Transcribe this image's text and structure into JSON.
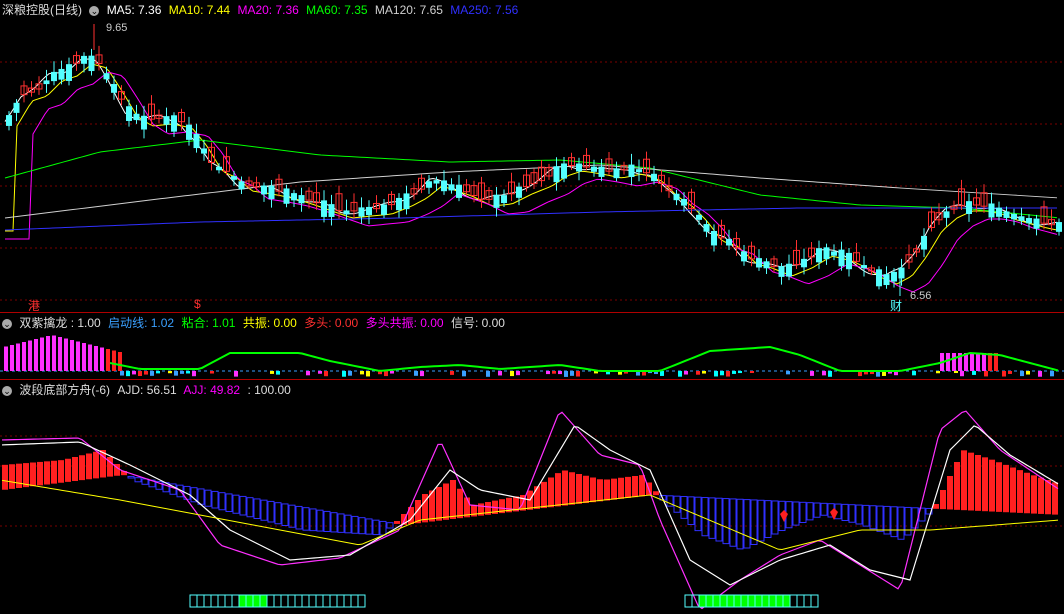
{
  "colors": {
    "ma5": "#ffffff",
    "ma10": "#ffff00",
    "ma20": "#ff00ff",
    "ma60": "#00ff00",
    "ma120": "#d0d0d0",
    "ma250": "#3030ff",
    "up": "#ff3030",
    "down": "#54ffff"
  },
  "main": {
    "title": "深粮控股(日线)",
    "ma5": "MA5: 7.36",
    "ma10": "MA10: 7.44",
    "ma20": "MA20: 7.36",
    "ma60": "MA60: 7.35",
    "ma120": "MA120: 7.65",
    "ma250": "MA250: 7.56",
    "high_label": "9.65",
    "low_label": "6.56",
    "marker_gang": "港",
    "marker_dollar": "$",
    "marker_cai": "财"
  },
  "ind1": {
    "name": "双紫擒龙",
    "v0": ": 1.00",
    "qdx": "启动线: 1.02",
    "nh": "粘合: 1.01",
    "gz": "共振: 0.00",
    "dt": "多头: 0.00",
    "dtgz": "多头共振: 0.00",
    "xh": "信号: 0.00"
  },
  "ind2": {
    "name": "波段底部方舟(-6)",
    "ajd": "AJD: 56.51",
    "ajj": "AJJ: 49.82",
    "v100": ": 100.00"
  }
}
